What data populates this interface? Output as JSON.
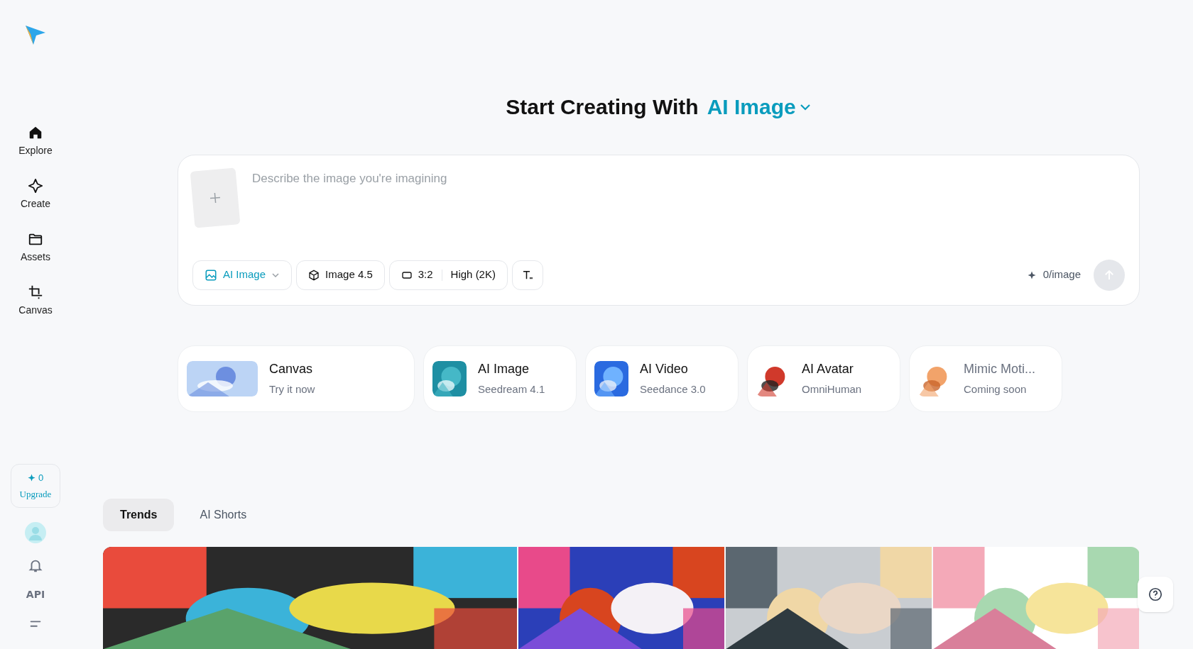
{
  "sidebar": {
    "nav": [
      {
        "label": "Explore"
      },
      {
        "label": "Create"
      },
      {
        "label": "Assets"
      },
      {
        "label": "Canvas"
      }
    ],
    "credits": {
      "count": "0",
      "action": "Upgrade"
    },
    "api": "API"
  },
  "heading": {
    "prefix": "Start Creating With",
    "mode": "AI Image"
  },
  "prompt": {
    "placeholder": "Describe the image you're imagining",
    "mode": "AI Image",
    "model": "Image 4.5",
    "ratio": "3:2",
    "quality": "High (2K)",
    "cost": "0/image"
  },
  "features": [
    {
      "title": "Canvas",
      "subtitle": "Try it now",
      "disabled": false
    },
    {
      "title": "AI Image",
      "subtitle": "Seedream 4.1",
      "disabled": false
    },
    {
      "title": "AI Video",
      "subtitle": "Seedance 3.0",
      "disabled": false
    },
    {
      "title": "AI Avatar",
      "subtitle": "OmniHuman",
      "disabled": false
    },
    {
      "title": "Mimic Moti...",
      "subtitle": "Coming soon",
      "disabled": true
    }
  ],
  "tabs": [
    {
      "label": "Trends",
      "selected": true
    },
    {
      "label": "AI Shorts",
      "selected": false
    }
  ]
}
